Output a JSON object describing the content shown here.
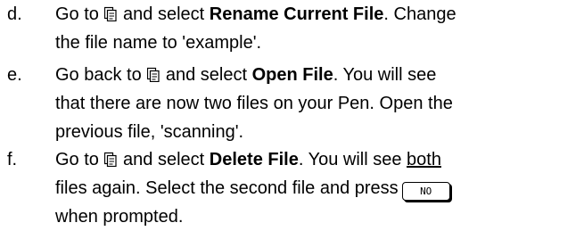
{
  "steps": [
    {
      "marker": "d.",
      "line1": {
        "pre": "Go to ",
        "post": " and select ",
        "bold": "Rename Current File",
        "tail": ". Change"
      },
      "line2": "the file name to 'example'."
    },
    {
      "marker": "e.",
      "line1": {
        "pre": "Go back to ",
        "post": " and select ",
        "bold": "Open File",
        "tail": ". You will see"
      },
      "line2": "that there are now two files on your Pen. Open the",
      "line3": "previous file, 'scanning'."
    },
    {
      "marker": "f.",
      "line1": {
        "pre": "Go to ",
        "post": " and select ",
        "bold": "Delete File",
        "mid": ". You will see ",
        "underlined": "both"
      },
      "line2": {
        "pre": "files again. Select the second file and press",
        "button": "NO"
      },
      "line3": "when prompted."
    }
  ],
  "icons": {
    "menu_icon": "file-menu-icon"
  }
}
